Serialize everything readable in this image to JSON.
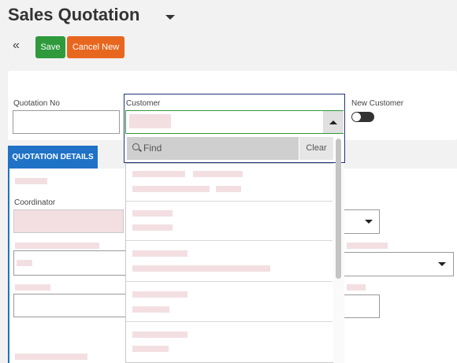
{
  "page": {
    "title": "Sales Quotation"
  },
  "toolbar": {
    "save_label": "Save",
    "cancel_new_label": "Cancel New"
  },
  "form": {
    "quotation_no_label": "Quotation No",
    "quotation_no_value": "",
    "customer_label": "Customer",
    "new_customer_label": "New Customer",
    "new_customer_enabled": false
  },
  "customer_dropdown": {
    "find_placeholder": "Find",
    "clear_label": "Clear"
  },
  "tabs": {
    "details_label": "QUOTATION DETAILS"
  },
  "details": {
    "coordinator_label": "Coordinator"
  },
  "colors": {
    "save": "#2f9a3c",
    "cancel": "#e8671f",
    "tab": "#1f72c6",
    "focus_border": "#22347a"
  }
}
